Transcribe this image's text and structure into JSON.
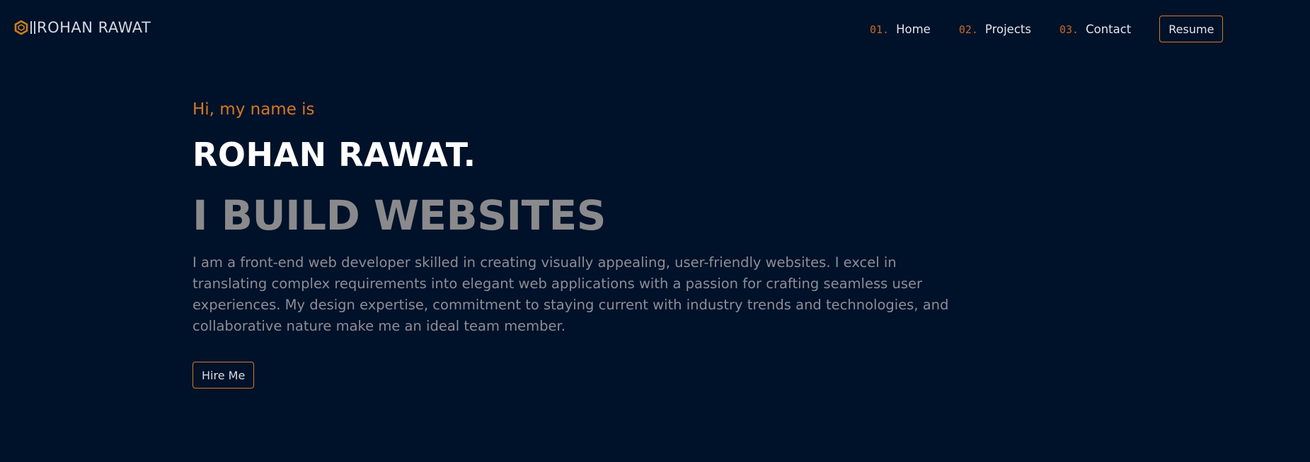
{
  "header": {
    "brand_name": "ROHAN RAWAT",
    "logo_icon": "hexagon-logo-icon",
    "nav": [
      {
        "num": "01.",
        "label": "Home"
      },
      {
        "num": "02.",
        "label": "Projects"
      },
      {
        "num": "03.",
        "label": "Contact"
      }
    ],
    "resume_label": "Resume"
  },
  "hero": {
    "greeting": "Hi, my name is",
    "name": "ROHAN RAWAT.",
    "tagline": "I BUILD WEBSITES",
    "bio": "I am a front-end web developer skilled in creating visually appealing, user-friendly websites. I excel in translating complex requirements into elegant web applications with a passion for crafting seamless user experiences. My design expertise, commitment to staying current with industry trends and technologies, and collaborative nature make me an ideal team member.",
    "hire_label": "Hire Me"
  },
  "colors": {
    "background": "#00112a",
    "accent": "#c8801c",
    "greeting": "#d27924",
    "heading": "#ffffff",
    "muted": "#8a8a8c"
  }
}
